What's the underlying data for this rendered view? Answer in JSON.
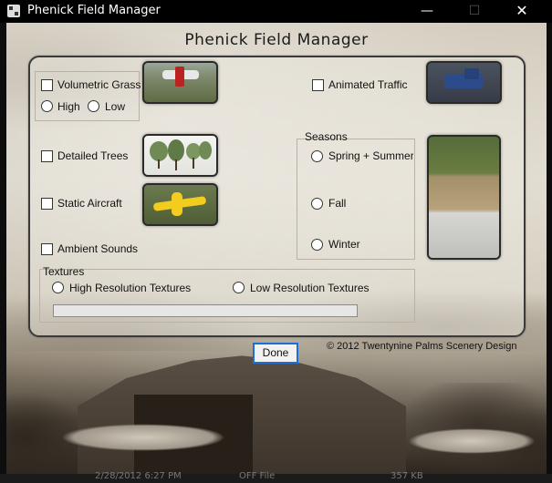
{
  "window": {
    "title": "Phenick Field Manager",
    "minimize_glyph": "—",
    "maximize_glyph": "☐",
    "close_glyph": "✕"
  },
  "app": {
    "heading": "Phenick Field Manager"
  },
  "options": {
    "volumetric_grass": {
      "label": "Volumetric Grass",
      "checked": false
    },
    "grass_high": {
      "label": "High",
      "selected": false
    },
    "grass_low": {
      "label": "Low",
      "selected": false
    },
    "animated_traffic": {
      "label": "Animated Traffic",
      "checked": false
    },
    "detailed_trees": {
      "label": "Detailed Trees",
      "checked": false
    },
    "static_aircraft": {
      "label": "Static Aircraft",
      "checked": false
    },
    "ambient_sounds": {
      "label": "Ambient Sounds",
      "checked": false
    }
  },
  "seasons": {
    "label": "Seasons",
    "spring_summer": "Spring + Summer",
    "fall": "Fall",
    "winter": "Winter"
  },
  "textures": {
    "label": "Textures",
    "high": "High Resolution Textures",
    "low": "Low Resolution Textures",
    "progress": 0
  },
  "done_label": "Done",
  "copyright": "© 2012 Twentynine Palms Scenery Design",
  "background_row": {
    "date": "2/28/2012 6:27 PM",
    "type": "OFF File",
    "size": "357 KB"
  },
  "colors": {
    "focus_border": "#1f6fd1",
    "titlebar": "#000000"
  }
}
